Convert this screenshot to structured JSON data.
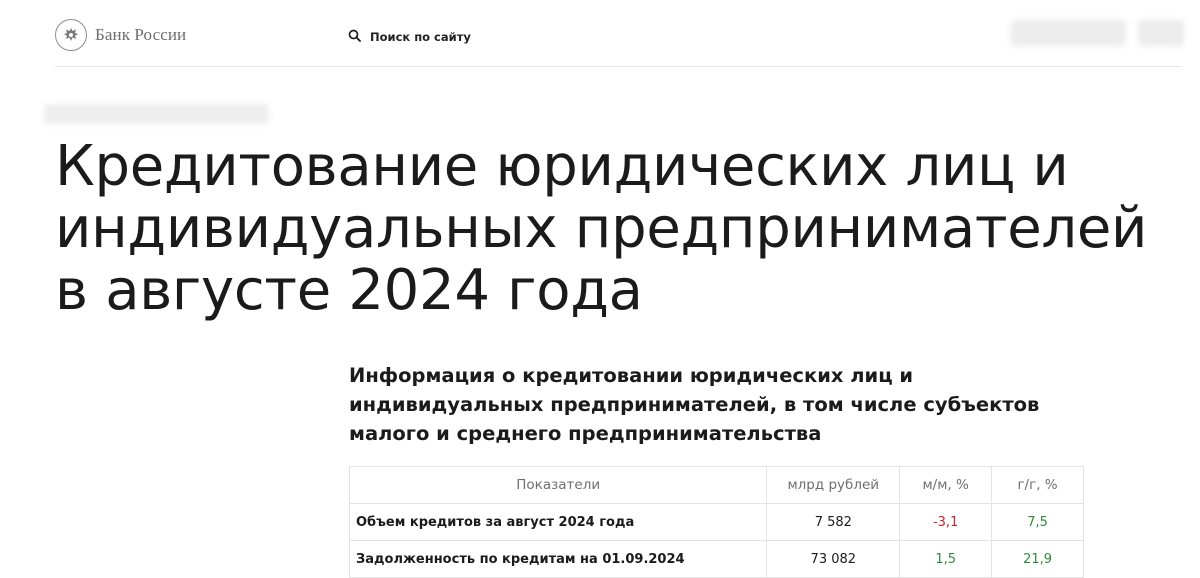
{
  "header": {
    "logo_text": "Банк России",
    "search_label": "Поиск по сайту",
    "emblem_icon": "double-headed-eagle-icon",
    "search_icon": "search-icon"
  },
  "page": {
    "title": "Кредитование юридических лиц и индивидуальных предпринимателей в августе 2024 года",
    "subtitle": "Информация о кредитовании юридических лиц и индивидуальных предпринимателей, в том числе субъектов малого и среднего предпринимательства"
  },
  "table": {
    "headers": [
      "Показатели",
      "млрд рублей",
      "м/м, %",
      "г/г, %"
    ],
    "rows": [
      {
        "label": "Объем кредитов за август 2024 года",
        "value": "7 582",
        "mom": "-3,1",
        "yoy": "7,5"
      },
      {
        "label": "Задолженность по кредитам на 01.09.2024",
        "value": "73 082",
        "mom": "1,5",
        "yoy": "21,9"
      }
    ]
  },
  "colors": {
    "negative": "#c0282d",
    "positive": "#2e8b3d"
  }
}
